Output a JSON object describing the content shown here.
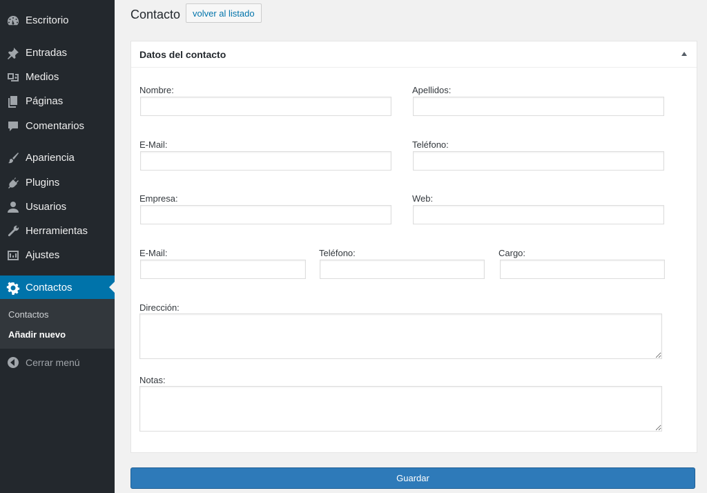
{
  "sidebar": {
    "items": [
      {
        "label": "Escritorio",
        "icon": "dashboard-icon"
      },
      {
        "label": "Entradas",
        "icon": "pin-icon"
      },
      {
        "label": "Medios",
        "icon": "media-icon"
      },
      {
        "label": "Páginas",
        "icon": "pages-icon"
      },
      {
        "label": "Comentarios",
        "icon": "comment-icon"
      },
      {
        "label": "Apariencia",
        "icon": "brush-icon"
      },
      {
        "label": "Plugins",
        "icon": "plugin-icon"
      },
      {
        "label": "Usuarios",
        "icon": "user-icon"
      },
      {
        "label": "Herramientas",
        "icon": "wrench-icon"
      },
      {
        "label": "Ajustes",
        "icon": "settings-icon"
      },
      {
        "label": "Contactos",
        "icon": "gear-icon",
        "active": true
      }
    ],
    "submenu": [
      {
        "label": "Contactos"
      },
      {
        "label": "Añadir nuevo",
        "current": true
      }
    ],
    "collapse_label": "Cerrar menú"
  },
  "header": {
    "title": "Contacto",
    "back_label": "volver al listado"
  },
  "form": {
    "section_title": "Datos del contacto",
    "fields": {
      "nombre": {
        "label": "Nombre:",
        "value": ""
      },
      "apellidos": {
        "label": "Apellidos:",
        "value": ""
      },
      "email": {
        "label": "E-Mail:",
        "value": ""
      },
      "telefono": {
        "label": "Teléfono:",
        "value": ""
      },
      "empresa": {
        "label": "Empresa:",
        "value": ""
      },
      "web": {
        "label": "Web:",
        "value": ""
      },
      "empresa_email": {
        "label": "E-Mail:",
        "value": ""
      },
      "empresa_telefono": {
        "label": "Teléfono:",
        "value": ""
      },
      "cargo": {
        "label": "Cargo:",
        "value": ""
      },
      "direccion": {
        "label": "Dirección:",
        "value": ""
      },
      "notas": {
        "label": "Notas:",
        "value": ""
      }
    },
    "save_label": "Guardar"
  },
  "colors": {
    "sidebar_bg": "#23282d",
    "accent": "#0073aa",
    "save_button": "#2e7ab9"
  }
}
